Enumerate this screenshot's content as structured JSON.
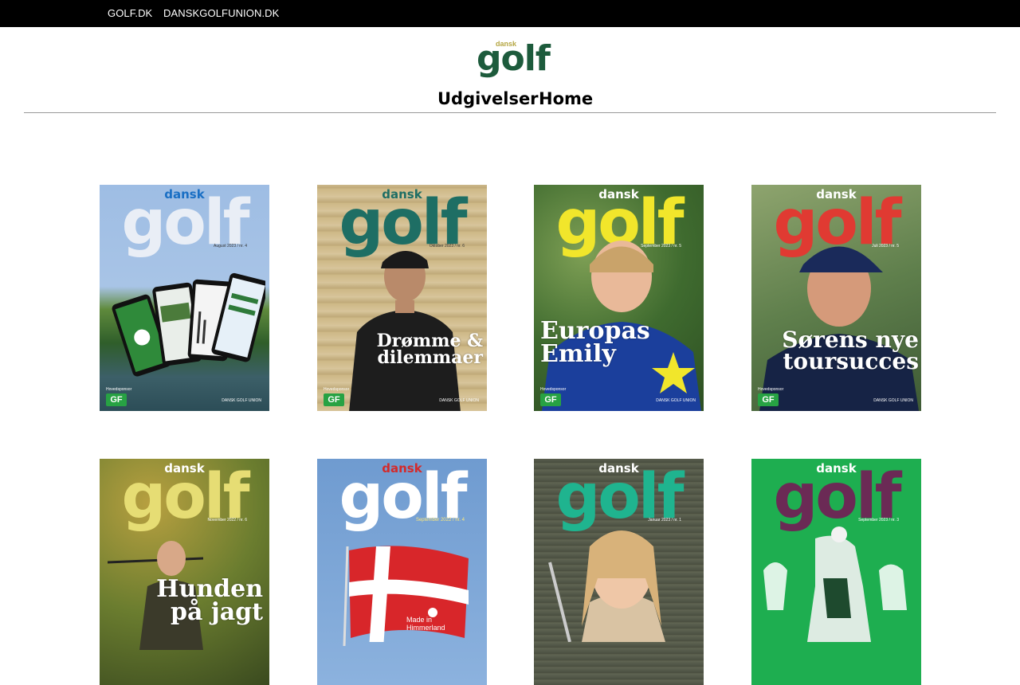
{
  "topbar": {
    "links": [
      {
        "label": "GOLF.DK"
      },
      {
        "label": "DANSKGOLFUNION.DK"
      }
    ]
  },
  "logo": {
    "small": "dansk",
    "main": "golf",
    "colors": {
      "small": "#b5a642",
      "main": "#1d5b3c"
    }
  },
  "nav": {
    "items": [
      {
        "label": "Udgivelser"
      },
      {
        "label": "Home"
      }
    ]
  },
  "covers": [
    {
      "dansk": "dansk",
      "golf": "golf",
      "issue": "August 2023 / nr. 4",
      "headline": "",
      "caption": "Hovedsponsor",
      "publisher": "DANSK GOLF UNION",
      "colors": {
        "bg": "#8fb2de",
        "dansk": "#1a6fc4",
        "golf": "#e9eef6"
      }
    },
    {
      "dansk": "dansk",
      "golf": "golf",
      "issue": "Oktober 2023 / nr. 6",
      "headline": "Drømme & dilemmaer",
      "caption": "Hovedsponsor",
      "publisher": "DANSK GOLF UNION",
      "colors": {
        "bg": "#c9b386",
        "dansk": "#1e6e64",
        "golf": "#1e6e64"
      }
    },
    {
      "dansk": "dansk",
      "golf": "golf",
      "issue": "September 2023 / nr. 5",
      "headline": "Europas Emily",
      "caption": "Hovedsponsor",
      "publisher": "DANSK GOLF UNION",
      "colors": {
        "bg": "#3f6b2f",
        "dansk": "#ffffff",
        "golf": "#f1e62b"
      }
    },
    {
      "dansk": "dansk",
      "golf": "golf",
      "issue": "Juli 2023 / nr. 5",
      "headline": "Sørens nye toursucces",
      "caption": "Hovedsponsor",
      "publisher": "DANSK GOLF UNION",
      "colors": {
        "bg": "#5f7f4c",
        "dansk": "#ffffff",
        "golf": "#e03a32"
      }
    },
    {
      "dansk": "dansk",
      "golf": "golf",
      "issue": "November 2022 / nr. 6",
      "headline": "Hunden på jagt",
      "caption": "",
      "publisher": "",
      "colors": {
        "bg": "#6b7d2f",
        "dansk": "#ffffff",
        "golf": "#e6dd74"
      }
    },
    {
      "dansk": "dansk",
      "golf": "golf",
      "issue": "September 2022 / nr. 4",
      "headline": "",
      "caption": "",
      "publisher": "",
      "colors": {
        "bg": "#7ea4d3",
        "dansk": "#d42a2a",
        "golf": "#ffffff"
      }
    },
    {
      "dansk": "dansk",
      "golf": "golf",
      "issue": "Januar 2023 / nr. 1",
      "headline": "",
      "caption": "",
      "publisher": "",
      "colors": {
        "bg": "#5a5f4f",
        "dansk": "#ffffff",
        "golf": "#1fb48f"
      }
    },
    {
      "dansk": "dansk",
      "golf": "golf",
      "issue": "September 2023 / nr. 3",
      "headline": "",
      "caption": "",
      "publisher": "",
      "colors": {
        "bg": "#1eae50",
        "dansk": "#ffffff",
        "golf": "#6b2a55"
      }
    }
  ],
  "flag_text": "Made in Himmerland"
}
